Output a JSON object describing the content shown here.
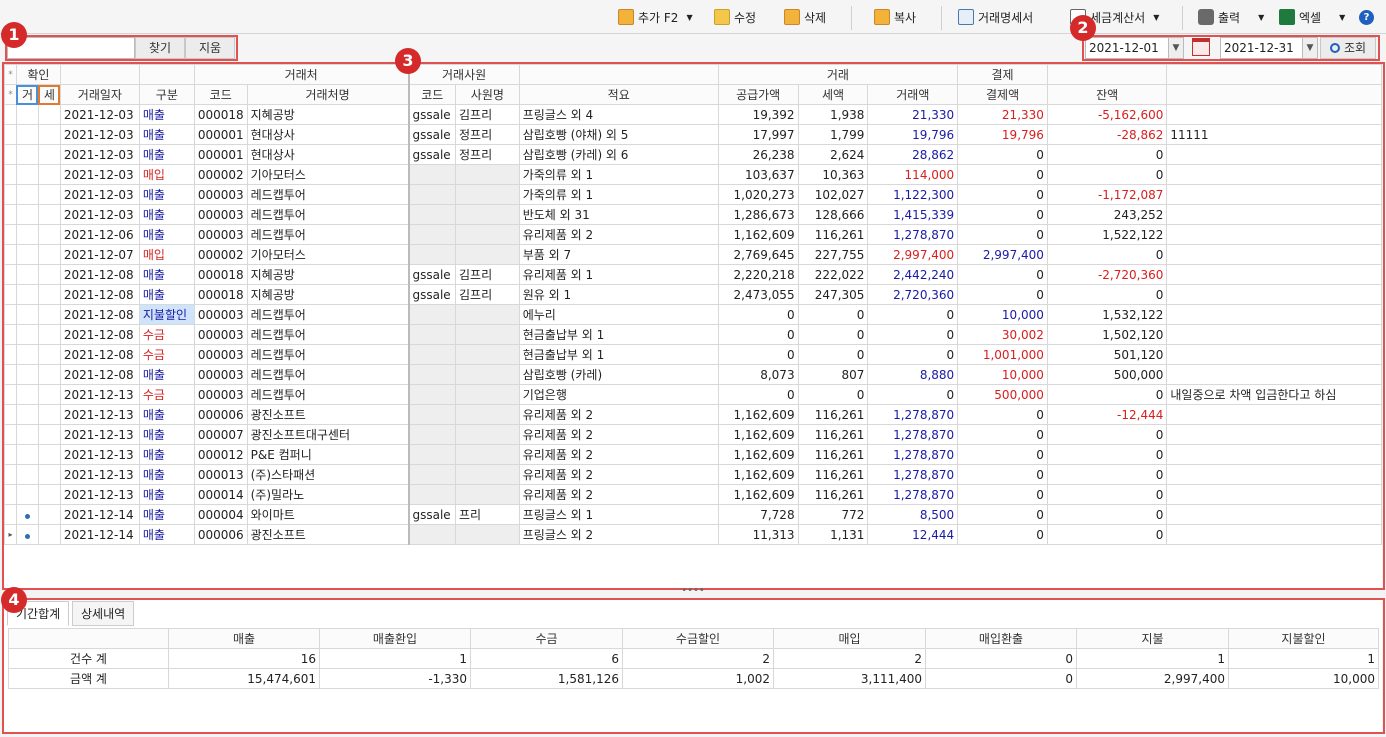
{
  "toolbar": {
    "add": "추가 F2",
    "edit": "수정",
    "delete": "삭제",
    "copy": "복사",
    "statement": "거래명세서",
    "tax_invoice": "세금계산서",
    "print": "출력",
    "excel": "엑셀",
    "help": "?"
  },
  "search": {
    "value": "",
    "find": "찾기",
    "clear": "지움"
  },
  "date": {
    "from": "2021-12-01",
    "to": "2021-12-31",
    "query": "조회"
  },
  "callouts": [
    "1",
    "2",
    "3",
    "4"
  ],
  "grid": {
    "group_headers": {
      "confirm": "확인",
      "partner": "거래처",
      "employee": "거래사원",
      "trade": "거래",
      "payment": "결제"
    },
    "headers": {
      "star": "*",
      "geo": "거",
      "se": "세",
      "date": "거래일자",
      "type": "구분",
      "code": "코드",
      "partner_name": "거래처명",
      "emp_code": "코드",
      "emp_name": "사원명",
      "desc": "적요",
      "supply": "공급가액",
      "tax": "세액",
      "amount": "거래액",
      "paid": "결제액",
      "balance": "잔액"
    },
    "rows": [
      {
        "dot": "",
        "mark": "",
        "date": "2021-12-03",
        "type": "매출",
        "tc": "sal",
        "code": "000018",
        "name": "지혜공방",
        "ec": "gssale",
        "en": "김프리",
        "desc": "프링글스 외 4",
        "supply": "19,392",
        "tax": "1,938",
        "amt": "21,330",
        "paid": "21,330",
        "pc": "red",
        "bal": "-5,162,600",
        "bc": "red",
        "note": ""
      },
      {
        "dot": "",
        "mark": "",
        "date": "2021-12-03",
        "type": "매출",
        "tc": "sal",
        "code": "000001",
        "name": "현대상사",
        "ec": "gssale",
        "en": "정프리",
        "desc": "삼립호빵 (야채) 외 5",
        "supply": "17,997",
        "tax": "1,799",
        "amt": "19,796",
        "paid": "19,796",
        "pc": "red",
        "bal": "-28,862",
        "bc": "red",
        "note": "11111"
      },
      {
        "dot": "",
        "mark": "",
        "date": "2021-12-03",
        "type": "매출",
        "tc": "sal",
        "code": "000001",
        "name": "현대상사",
        "ec": "gssale",
        "en": "정프리",
        "desc": "삼립호빵 (카레) 외 6",
        "supply": "26,238",
        "tax": "2,624",
        "amt": "28,862",
        "paid": "0",
        "pc": "",
        "bal": "0",
        "bc": "",
        "note": ""
      },
      {
        "dot": "",
        "mark": "",
        "date": "2021-12-03",
        "type": "매입",
        "tc": "pur",
        "code": "000002",
        "name": "기아모터스",
        "ec": "",
        "en": "",
        "desc": "가죽의류 외 1",
        "supply": "103,637",
        "tax": "10,363",
        "amt": "114,000",
        "ac": "red",
        "paid": "0",
        "pc": "",
        "bal": "0",
        "bc": "",
        "note": ""
      },
      {
        "dot": "",
        "mark": "",
        "date": "2021-12-03",
        "type": "매출",
        "tc": "sal",
        "code": "000003",
        "name": "레드캡투어",
        "ec": "",
        "en": "",
        "desc": "가죽의류 외 1",
        "supply": "1,020,273",
        "tax": "102,027",
        "amt": "1,122,300",
        "paid": "0",
        "pc": "",
        "bal": "-1,172,087",
        "bc": "red",
        "note": ""
      },
      {
        "dot": "",
        "mark": "",
        "date": "2021-12-03",
        "type": "매출",
        "tc": "sal",
        "code": "000003",
        "name": "레드캡투어",
        "ec": "",
        "en": "",
        "desc": "반도체 외 31",
        "supply": "1,286,673",
        "tax": "128,666",
        "amt": "1,415,339",
        "paid": "0",
        "pc": "",
        "bal": "243,252",
        "bc": "",
        "note": ""
      },
      {
        "dot": "",
        "mark": "",
        "date": "2021-12-06",
        "type": "매출",
        "tc": "sal",
        "code": "000003",
        "name": "레드캡투어",
        "ec": "",
        "en": "",
        "desc": "유리제품 외 2",
        "supply": "1,162,609",
        "tax": "116,261",
        "amt": "1,278,870",
        "paid": "0",
        "pc": "",
        "bal": "1,522,122",
        "bc": "",
        "note": ""
      },
      {
        "dot": "",
        "mark": "",
        "date": "2021-12-07",
        "type": "매입",
        "tc": "pur",
        "code": "000002",
        "name": "기아모터스",
        "ec": "",
        "en": "",
        "desc": "부품 외 7",
        "supply": "2,769,645",
        "tax": "227,755",
        "amt": "2,997,400",
        "ac": "red",
        "paid": "2,997,400",
        "pc": "blue",
        "bal": "0",
        "bc": "",
        "note": ""
      },
      {
        "dot": "",
        "mark": "",
        "date": "2021-12-08",
        "type": "매출",
        "tc": "sal",
        "code": "000018",
        "name": "지혜공방",
        "ec": "gssale",
        "en": "김프리",
        "desc": "유리제품 외 1",
        "supply": "2,220,218",
        "tax": "222,022",
        "amt": "2,442,240",
        "paid": "0",
        "pc": "",
        "bal": "-2,720,360",
        "bc": "red",
        "note": ""
      },
      {
        "dot": "",
        "mark": "",
        "date": "2021-12-08",
        "type": "매출",
        "tc": "sal",
        "code": "000018",
        "name": "지혜공방",
        "ec": "gssale",
        "en": "김프리",
        "desc": "원유 외 1",
        "supply": "2,473,055",
        "tax": "247,305",
        "amt": "2,720,360",
        "paid": "0",
        "pc": "",
        "bal": "0",
        "bc": "",
        "note": ""
      },
      {
        "dot": "",
        "mark": "gray",
        "date": "2021-12-08",
        "type": "지불할인",
        "tc": "hl",
        "code": "000003",
        "name": "레드캡투어",
        "ec": "",
        "en": "",
        "desc": "에누리",
        "supply": "0",
        "tax": "0",
        "amt": "0",
        "ac": "plain",
        "paid": "10,000",
        "pc": "blue",
        "bal": "1,532,122",
        "bc": "",
        "note": ""
      },
      {
        "dot": "",
        "mark": "gray",
        "date": "2021-12-08",
        "type": "수금",
        "tc": "pur",
        "code": "000003",
        "name": "레드캡투어",
        "ec": "",
        "en": "",
        "desc": "현금출납부 외 1",
        "supply": "0",
        "tax": "0",
        "amt": "0",
        "ac": "plain",
        "paid": "30,002",
        "pc": "red",
        "bal": "1,502,120",
        "bc": "",
        "note": ""
      },
      {
        "dot": "",
        "mark": "gray",
        "date": "2021-12-08",
        "type": "수금",
        "tc": "pur",
        "code": "000003",
        "name": "레드캡투어",
        "ec": "",
        "en": "",
        "desc": "현금출납부 외 1",
        "supply": "0",
        "tax": "0",
        "amt": "0",
        "ac": "plain",
        "paid": "1,001,000",
        "pc": "red",
        "bal": "501,120",
        "bc": "",
        "note": ""
      },
      {
        "dot": "",
        "mark": "",
        "date": "2021-12-08",
        "type": "매출",
        "tc": "sal",
        "code": "000003",
        "name": "레드캡투어",
        "ec": "",
        "en": "",
        "desc": "삼립호빵 (카레)",
        "supply": "8,073",
        "tax": "807",
        "amt": "8,880",
        "paid": "10,000",
        "pc": "red",
        "bal": "500,000",
        "bc": "",
        "note": ""
      },
      {
        "dot": "",
        "mark": "gray",
        "date": "2021-12-13",
        "type": "수금",
        "tc": "pur",
        "code": "000003",
        "name": "레드캡투어",
        "ec": "",
        "en": "",
        "desc": "기업은행",
        "supply": "0",
        "tax": "0",
        "amt": "0",
        "ac": "plain",
        "paid": "500,000",
        "pc": "red",
        "bal": "0",
        "bc": "",
        "note": "내일중으로 차액 입금한다고 하심"
      },
      {
        "dot": "",
        "mark": "",
        "date": "2021-12-13",
        "type": "매출",
        "tc": "sal",
        "code": "000006",
        "name": "광진소프트",
        "ec": "",
        "en": "",
        "desc": "유리제품 외 2",
        "supply": "1,162,609",
        "tax": "116,261",
        "amt": "1,278,870",
        "paid": "0",
        "pc": "",
        "bal": "-12,444",
        "bc": "red",
        "note": ""
      },
      {
        "dot": "",
        "mark": "",
        "date": "2021-12-13",
        "type": "매출",
        "tc": "sal",
        "code": "000007",
        "name": "광진소프트대구센터",
        "ec": "",
        "en": "",
        "desc": "유리제품 외 2",
        "supply": "1,162,609",
        "tax": "116,261",
        "amt": "1,278,870",
        "paid": "0",
        "pc": "",
        "bal": "0",
        "bc": "",
        "note": ""
      },
      {
        "dot": "",
        "mark": "",
        "date": "2021-12-13",
        "type": "매출",
        "tc": "sal",
        "code": "000012",
        "name": "P&E 컴퍼니",
        "ec": "",
        "en": "",
        "desc": "유리제품 외 2",
        "supply": "1,162,609",
        "tax": "116,261",
        "amt": "1,278,870",
        "paid": "0",
        "pc": "",
        "bal": "0",
        "bc": "",
        "note": ""
      },
      {
        "dot": "",
        "mark": "",
        "date": "2021-12-13",
        "type": "매출",
        "tc": "sal",
        "code": "000013",
        "name": "(주)스타패션",
        "ec": "",
        "en": "",
        "desc": "유리제품 외 2",
        "supply": "1,162,609",
        "tax": "116,261",
        "amt": "1,278,870",
        "paid": "0",
        "pc": "",
        "bal": "0",
        "bc": "",
        "note": ""
      },
      {
        "dot": "",
        "mark": "",
        "date": "2021-12-13",
        "type": "매출",
        "tc": "sal",
        "code": "000014",
        "name": "(주)밀라노",
        "ec": "",
        "en": "",
        "desc": "유리제품 외 2",
        "supply": "1,162,609",
        "tax": "116,261",
        "amt": "1,278,870",
        "paid": "0",
        "pc": "",
        "bal": "0",
        "bc": "",
        "note": ""
      },
      {
        "dot": "y",
        "mark": "",
        "date": "2021-12-14",
        "type": "매출",
        "tc": "sal",
        "code": "000004",
        "name": "와이마트",
        "ec": "gssale",
        "en": "프리",
        "desc": "프링글스 외 1",
        "supply": "7,728",
        "tax": "772",
        "amt": "8,500",
        "paid": "0",
        "pc": "",
        "bal": "0",
        "bc": "",
        "note": ""
      },
      {
        "dot": "y",
        "mark": "",
        "date": "2021-12-14",
        "type": "매출",
        "tc": "sal",
        "code": "000006",
        "name": "광진소프트",
        "ec": "",
        "en": "",
        "desc": "프링글스 외 2",
        "supply": "11,313",
        "tax": "1,131",
        "amt": "12,444",
        "paid": "0",
        "pc": "",
        "bal": "0",
        "bc": "",
        "note": "",
        "current": true
      }
    ]
  },
  "tabs": [
    "기간합계",
    "상세내역"
  ],
  "summary": {
    "headers": [
      "",
      "매출",
      "매출환입",
      "수금",
      "수금할인",
      "매입",
      "매입환출",
      "지불",
      "지불할인"
    ],
    "rows": [
      [
        "건수 계",
        "16",
        "1",
        "6",
        "2",
        "2",
        "0",
        "1",
        "1"
      ],
      [
        "금액 계",
        "15,474,601",
        "-1,330",
        "1,581,126",
        "1,002",
        "3,111,400",
        "0",
        "2,997,400",
        "10,000"
      ]
    ]
  },
  "colors": {
    "accent_red": "#d42a2a",
    "sales_blue": "#1a1aa6",
    "purchase_red": "#d81e1e"
  }
}
